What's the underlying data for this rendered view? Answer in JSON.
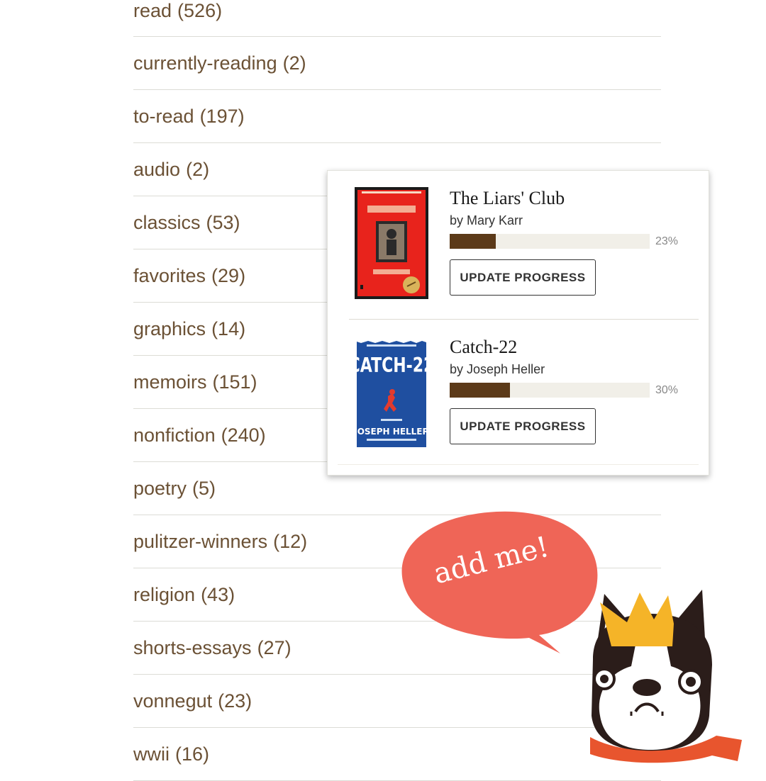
{
  "shelves": [
    {
      "name": "read",
      "count": "(526)"
    },
    {
      "name": "currently-reading",
      "count": "(2)"
    },
    {
      "name": "to-read",
      "count": "(197)"
    },
    {
      "name": "audio",
      "count": "(2)"
    },
    {
      "name": "classics",
      "count": "(53)"
    },
    {
      "name": "favorites",
      "count": "(29)"
    },
    {
      "name": "graphics",
      "count": "(14)"
    },
    {
      "name": "memoirs",
      "count": "(151)"
    },
    {
      "name": "nonfiction",
      "count": "(240)"
    },
    {
      "name": "poetry",
      "count": "(5)"
    },
    {
      "name": "pulitzer-winners",
      "count": "(12)"
    },
    {
      "name": "religion",
      "count": "(43)"
    },
    {
      "name": "shorts-essays",
      "count": "(27)"
    },
    {
      "name": "vonnegut",
      "count": "(23)"
    },
    {
      "name": "wwii",
      "count": "(16)"
    }
  ],
  "currently_reading": [
    {
      "title": "The Liars' Club",
      "author": "by Mary Karr",
      "progress_label": "23%",
      "progress": 0.23,
      "button": "UPDATE PROGRESS",
      "cover_color": "#e8231c"
    },
    {
      "title": "Catch-22",
      "author": "by Joseph Heller",
      "progress_label": "30%",
      "progress": 0.3,
      "button": "UPDATE PROGRESS",
      "cover_color": "#1f4fa0"
    }
  ],
  "sticker": {
    "bubble_text": "add me!",
    "bubble_color": "#ef6557"
  },
  "colors": {
    "shelf_text": "#6b5135",
    "progress_fill": "#5c3a19",
    "progress_track": "#f1efe8"
  }
}
